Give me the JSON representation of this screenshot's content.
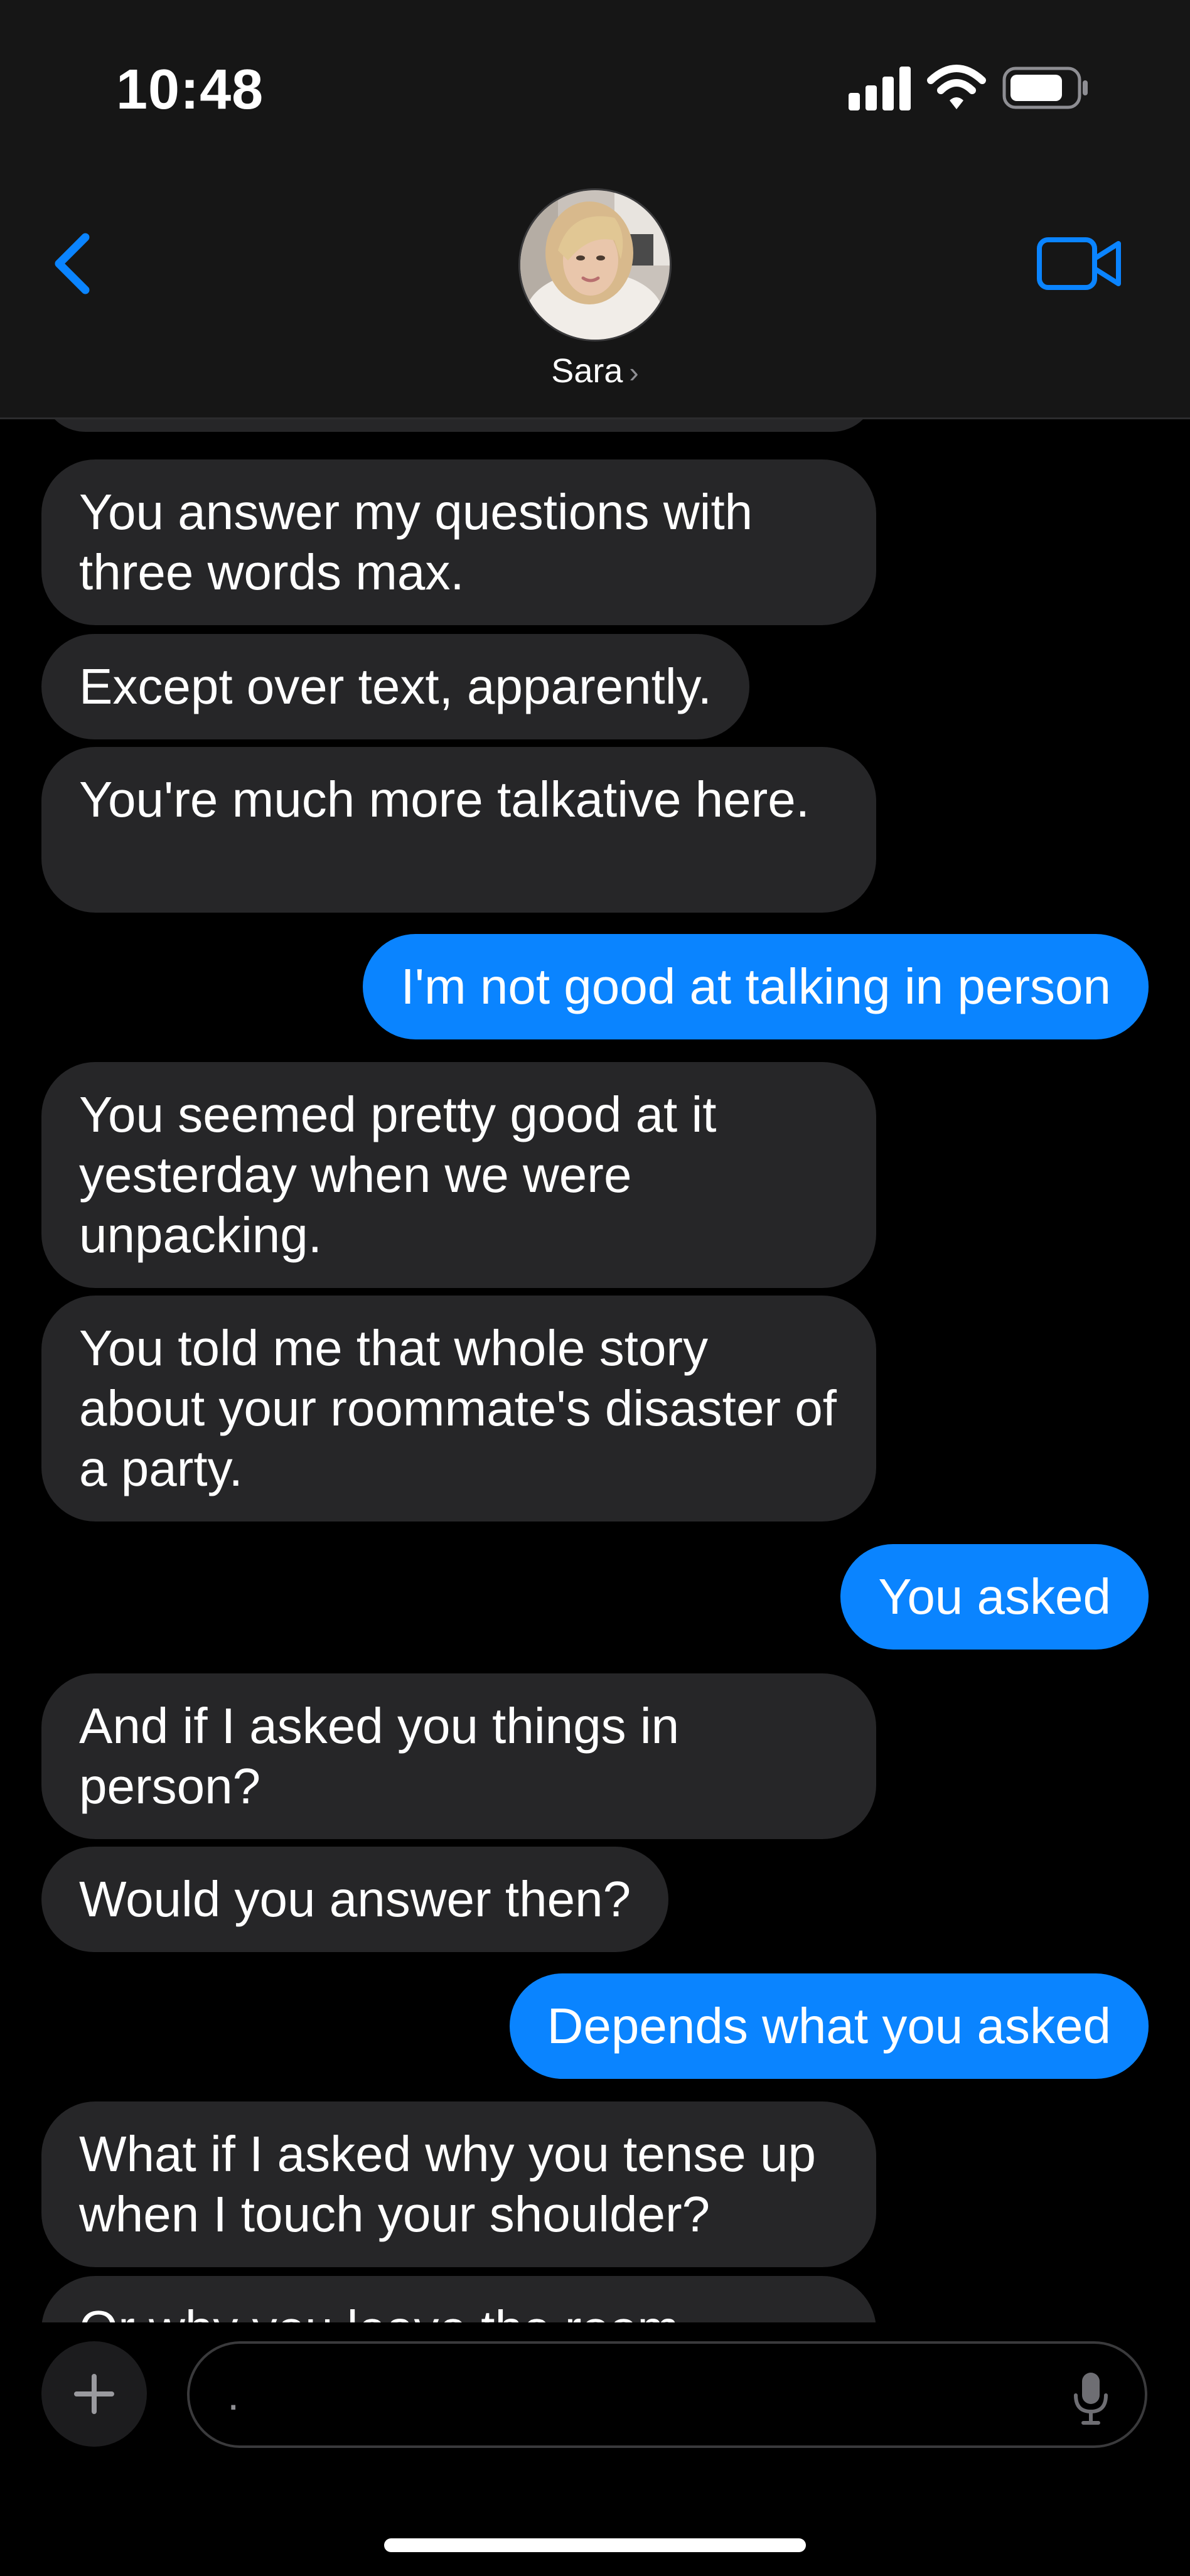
{
  "status_bar": {
    "time": "10:48"
  },
  "contact": {
    "name": "Sara",
    "chevron": "›"
  },
  "icons": {
    "back": "chevron-left-icon",
    "video": "video-camera-icon",
    "add": "plus-icon",
    "mic": "microphone-icon"
  },
  "colors": {
    "accent": "#0a84ff",
    "incoming_bubble": "#262628",
    "header_bg": "#161616"
  },
  "messages": [
    {
      "from": "them",
      "text": "You answer my questions with three words max."
    },
    {
      "from": "them",
      "text": "Except over text, apparently."
    },
    {
      "from": "them",
      "text": "You're much more talkative here."
    },
    {
      "from": "me",
      "text": "I'm not good at talking in person"
    },
    {
      "from": "them",
      "text": "You seemed pretty good at it yesterday when we were unpacking."
    },
    {
      "from": "them",
      "text": "You told me that whole story about your roommate's disaster of a party."
    },
    {
      "from": "me",
      "text": "You asked"
    },
    {
      "from": "them",
      "text": "And if I asked you things in person?"
    },
    {
      "from": "them",
      "text": "Would you answer then?"
    },
    {
      "from": "me",
      "text": "Depends what you asked"
    },
    {
      "from": "them",
      "text": "What if I asked why you tense up when I touch your shoulder?"
    },
    {
      "from": "them",
      "text": "Or why you leave the room"
    }
  ],
  "composer": {
    "input_value": "."
  }
}
